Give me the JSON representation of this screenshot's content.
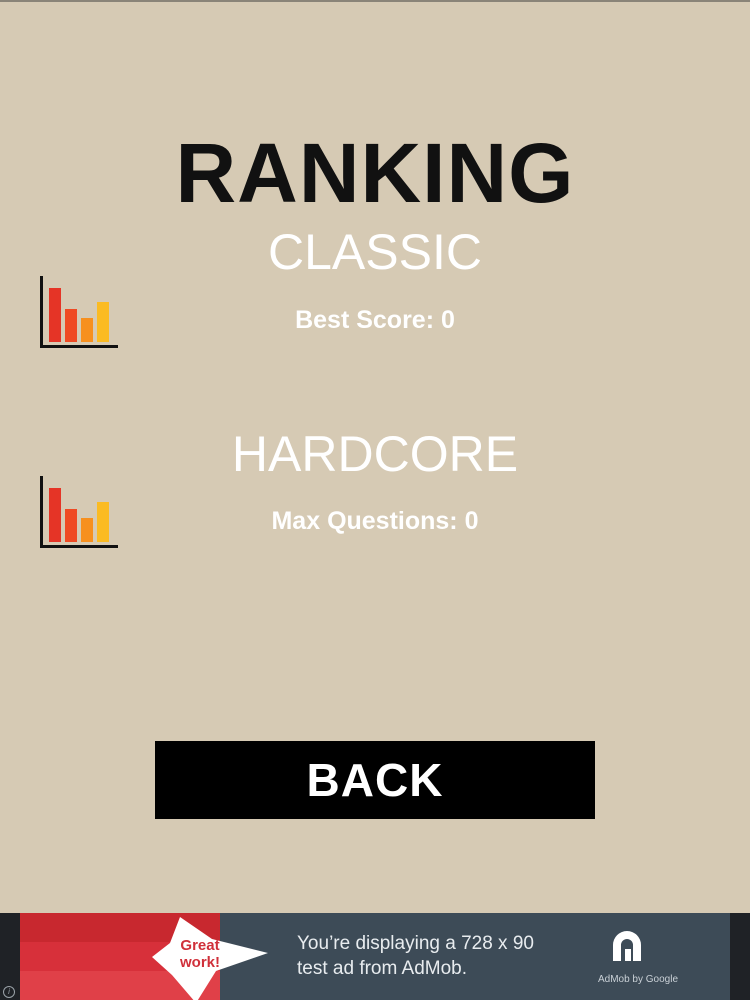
{
  "screen": {
    "title": "RANKING",
    "background_color": "#d6cab4"
  },
  "modes": [
    {
      "name": "CLASSIC",
      "stat_label": "Best Score:",
      "stat_value": "0",
      "icon": "bar-chart-icon"
    },
    {
      "name": "HARDCORE",
      "stat_label": "Max Questions:",
      "stat_value": "0",
      "icon": "bar-chart-icon"
    }
  ],
  "back_button": {
    "label": "BACK"
  },
  "ad": {
    "badge_line1": "Great",
    "badge_line2": "work!",
    "text_line1": "You’re displaying a 728 x 90",
    "text_line2": "test ad from AdMob.",
    "brand": "AdMob by Google",
    "info_glyph": "i"
  }
}
